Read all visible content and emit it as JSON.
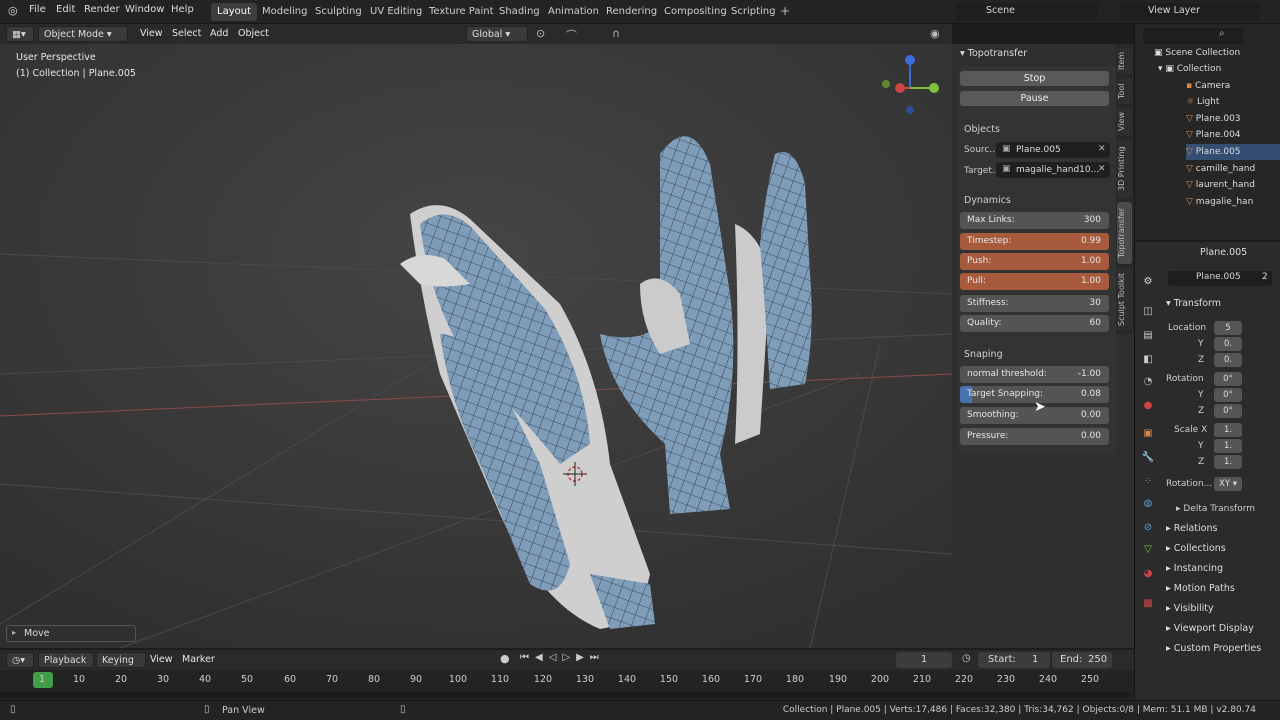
{
  "menus": [
    "File",
    "Edit",
    "Render",
    "Window",
    "Help"
  ],
  "workspaces": [
    "Layout",
    "Modeling",
    "Sculpting",
    "UV Editing",
    "Texture Paint",
    "Shading",
    "Animation",
    "Rendering",
    "Compositing",
    "Scripting"
  ],
  "scene_label": "Scene",
  "view_layer_label": "View Layer",
  "header3d": {
    "mode": "Object Mode",
    "view": "View",
    "select": "Select",
    "add": "Add",
    "object": "Object",
    "orientation": "Global"
  },
  "viewport": {
    "perspective": "User Perspective",
    "collection": "(1) Collection | Plane.005"
  },
  "topo": {
    "title": "Topotransfer",
    "stop": "Stop",
    "pause": "Pause",
    "objects": "Objects",
    "source_label": "Sourc..",
    "source_value": "Plane.005",
    "target_label": "Target..",
    "target_value": "magalie_hand10...",
    "dynamics": "Dynamics",
    "sliders": [
      {
        "label": "Max Links:",
        "value": "300",
        "progress": 0.0
      },
      {
        "label": "Timestep:",
        "value": "0.99",
        "progress": 0.99
      },
      {
        "label": "Push:",
        "value": "1.00",
        "progress": 1.0
      },
      {
        "label": "Pull:",
        "value": "1.00",
        "progress": 1.0
      },
      {
        "label": "Stiffness:",
        "value": "30",
        "progress": 0.0
      },
      {
        "label": "Quality:",
        "value": "60",
        "progress": 0.0
      }
    ],
    "snaping": "Snaping",
    "sliders2": [
      {
        "label": "normal threshold:",
        "value": "-1.00",
        "progress": 0.0
      },
      {
        "label": "Target Snapping:",
        "value": "0.08",
        "progress": 0.08
      },
      {
        "label": "Smoothing:",
        "value": "0.00",
        "progress": 0.0
      },
      {
        "label": "Pressure:",
        "value": "0.00",
        "progress": 0.0
      }
    ]
  },
  "vtabs": [
    "Item",
    "Tool",
    "View",
    "3D Printing",
    "Topotransfer",
    "Sculpt Toolkit"
  ],
  "outliner": {
    "scene_collection": "Scene Collection",
    "items": [
      "Collection",
      "Camera",
      "Light",
      "Plane.003",
      "Plane.004",
      "Plane.005",
      "camille_hand",
      "laurent_hand",
      "magalie_han"
    ]
  },
  "props": {
    "object": "Plane.005",
    "object2": "Plane.005",
    "users": "2",
    "transform": "Transform",
    "location_label": "Location",
    "rotation_label": "Rotation",
    "scale_label": "Scale X",
    "loc": [
      "5",
      "0.",
      "0."
    ],
    "rot": [
      "0°",
      "0°",
      "0°"
    ],
    "scale": [
      "1.",
      "1.",
      "1."
    ],
    "rotation_mode_label": "Rotation...",
    "rotation_mode": "XY",
    "delta": "Delta Transform",
    "sections": [
      "Relations",
      "Collections",
      "Instancing",
      "Motion Paths",
      "Visibility",
      "Viewport Display",
      "Custom Properties"
    ]
  },
  "move_panel": "Move",
  "timeline": {
    "playback": "Playback",
    "keying": "Keying",
    "view": "View",
    "marker": "Marker",
    "current": "1",
    "start_label": "Start:",
    "start": "1",
    "end_label": "End:",
    "end": "250",
    "ticks": [
      "1",
      "10",
      "20",
      "30",
      "40",
      "50",
      "60",
      "70",
      "80",
      "90",
      "100",
      "110",
      "120",
      "130",
      "140",
      "150",
      "160",
      "170",
      "180",
      "190",
      "200",
      "210",
      "220",
      "230",
      "240",
      "250"
    ]
  },
  "status": {
    "pan": "Pan View",
    "info": "Collection | Plane.005 | Verts:17,486 | Faces:32,380 | Tris:34,762 | Objects:0/8 | Mem: 51.1 MB | v2.80.74"
  }
}
